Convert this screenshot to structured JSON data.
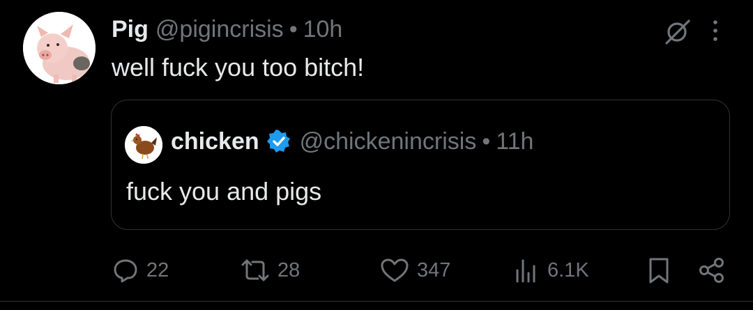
{
  "tweet": {
    "author_name": "Pig",
    "author_handle": "@pigincrisis",
    "separator": "•",
    "time": "10h",
    "text": "well fuck you too bitch!",
    "avatar_icon": "pig-avatar"
  },
  "quoted": {
    "author_name": "chicken",
    "verified": true,
    "author_handle": "@chickenincrisis",
    "separator": "•",
    "time": "11h",
    "text": "fuck you and pigs",
    "avatar_icon": "chicken-avatar"
  },
  "actions": {
    "replies": "22",
    "reposts": "28",
    "likes": "347",
    "views": "6.1K"
  },
  "colors": {
    "background": "#000000",
    "primary_text": "#e7e9ea",
    "secondary_text": "#71767b",
    "border": "#2f3336",
    "verified_badge": "#1d9bf0"
  }
}
